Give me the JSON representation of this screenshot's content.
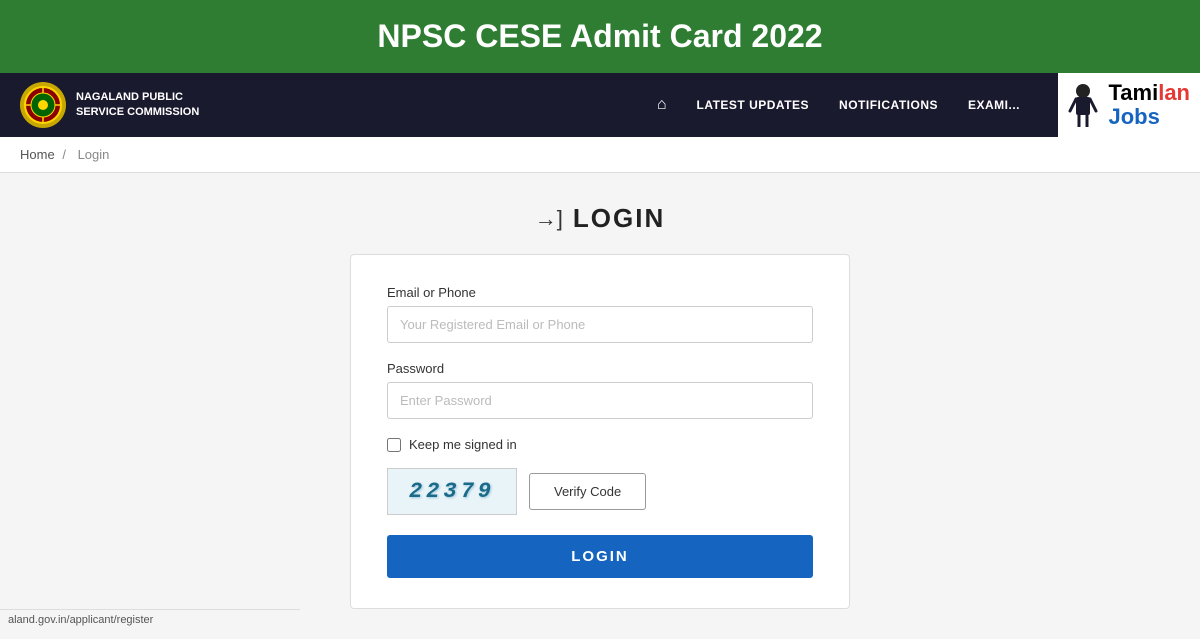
{
  "title_banner": {
    "text": "NPSC CESE Admit Card 2022",
    "bg_color": "#2e7d32"
  },
  "navbar": {
    "logo_text_line1": "NAGALAND PUBLIC",
    "logo_text_line2": "SERVICE COMMISSION",
    "nav_links": [
      {
        "label": "LATEST UPDATES",
        "key": "latest-updates"
      },
      {
        "label": "NOTIFICATIONS",
        "key": "notifications"
      },
      {
        "label": "EXAMI...",
        "key": "examinations"
      }
    ],
    "tamilan_text1": "Tamilan",
    "tamilan_text2": "Jobs"
  },
  "breadcrumb": {
    "home_label": "Home",
    "separator": "/",
    "current": "Login"
  },
  "login": {
    "icon": "→]",
    "title": "LOGIN",
    "email_label": "Email or Phone",
    "email_placeholder": "Your Registered Email or Phone",
    "password_label": "Password",
    "password_placeholder": "Enter Password",
    "keep_signed_label": "Keep me signed in",
    "captcha_text": "22379",
    "verify_btn_label": "Verify Code",
    "login_btn_label": "LOGIN"
  },
  "url_bar": {
    "text": "aland.gov.in/applicant/register"
  }
}
